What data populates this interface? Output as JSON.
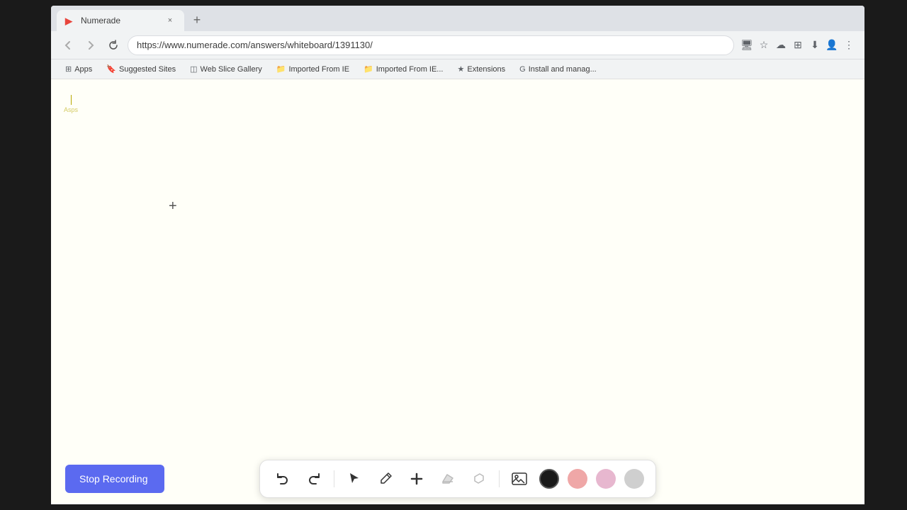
{
  "browser": {
    "tab": {
      "favicon": "N",
      "title": "Numerade",
      "close_label": "×"
    },
    "new_tab_label": "+",
    "nav": {
      "back_icon": "←",
      "forward_icon": "→",
      "refresh_icon": "↻",
      "url": "https://www.numerade.com/answers/whiteboard/1391130/",
      "icons": [
        "📷",
        "★",
        "☁",
        "⊞",
        "⬇",
        "👤",
        "⋮"
      ]
    },
    "bookmarks": [
      {
        "icon": "⊞",
        "label": "Apps"
      },
      {
        "icon": "🔖",
        "label": "Suggested Sites"
      },
      {
        "icon": "◫",
        "label": "Web Slice Gallery"
      },
      {
        "icon": "📁",
        "label": "Imported From IE"
      },
      {
        "icon": "📁",
        "label": "Imported From IE..."
      },
      {
        "icon": "★",
        "label": "Extensions"
      },
      {
        "icon": "G",
        "label": "Install and manag..."
      }
    ]
  },
  "whiteboard": {
    "cursor_label": "Asps",
    "plus_cursor": "+"
  },
  "toolbar": {
    "stop_recording_label": "Stop Recording",
    "buttons": {
      "undo_icon": "undo",
      "redo_icon": "redo",
      "select_icon": "select",
      "pen_icon": "pen",
      "add_icon": "add",
      "eraser_icon": "eraser",
      "lasso_icon": "lasso",
      "image_icon": "image"
    },
    "colors": {
      "black": "#1a1a1a",
      "red": "#e53e3e",
      "pink": "#f687b3",
      "gray": "#a0aec0"
    }
  }
}
